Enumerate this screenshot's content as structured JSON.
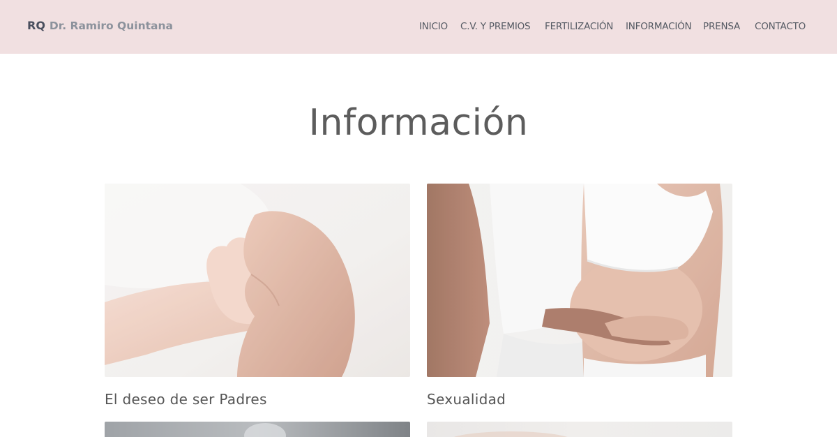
{
  "header": {
    "logo_mark": "RQ",
    "logo_name": "Dr. Ramiro Quintana",
    "background": "#f1e0e1"
  },
  "nav": {
    "items": [
      "INICIO",
      "C.V. Y PREMIOS",
      "FERTILIZACIÓN",
      "INFORMACIÓN",
      "PRENSA",
      "CONTACTO"
    ]
  },
  "main": {
    "title": "Información",
    "cards": [
      {
        "caption": "El deseo de ser Padres",
        "image": "baby-hand-holding-parent-finger-photo"
      },
      {
        "caption": "Sexualidad",
        "image": "couple-pregnant-belly-photo"
      },
      {
        "caption": "",
        "image": "gray-photo"
      },
      {
        "caption": "",
        "image": "light-photo"
      }
    ]
  }
}
